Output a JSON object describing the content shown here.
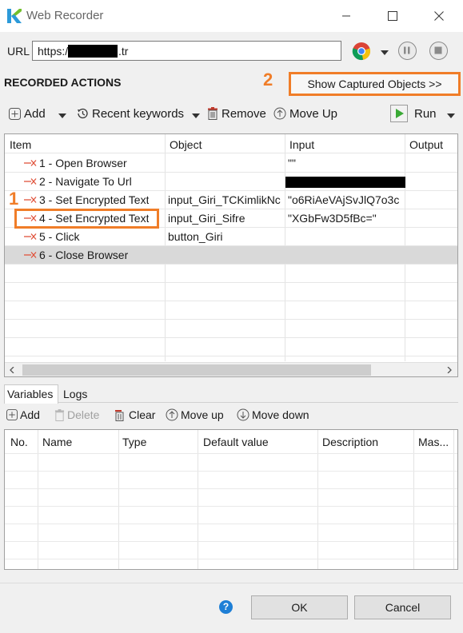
{
  "window": {
    "title": "Web Recorder",
    "minimize": "—",
    "maximize": "☐",
    "close": "✕"
  },
  "url_bar": {
    "label": "URL",
    "value_prefix": "https:/",
    "value_suffix": ".tr"
  },
  "section": {
    "title": "RECORDED ACTIONS",
    "show_captured": "Show Captured Objects >>",
    "annotation_1": "1",
    "annotation_2": "2"
  },
  "toolbar": {
    "add": "Add",
    "recent_keywords": "Recent keywords",
    "remove": "Remove",
    "move_up": "Move Up",
    "run": "Run"
  },
  "actions_table": {
    "columns": [
      "Item",
      "Object",
      "Input",
      "Output"
    ],
    "rows": [
      {
        "item": "1 - Open Browser",
        "object": "",
        "input": "\"\""
      },
      {
        "item": "2 - Navigate To Url",
        "object": "",
        "input": ""
      },
      {
        "item": "3 - Set Encrypted Text",
        "object": "input_Giri_TCKimlikNc",
        "input": "\"o6RiAeVAjSvJlQ7o3c"
      },
      {
        "item": "4 - Set Encrypted Text",
        "object": "input_Giri_Sifre",
        "input": "\"XGbFw3D5fBc=\""
      },
      {
        "item": "5 - Click",
        "object": "button_Giri",
        "input": ""
      },
      {
        "item": "6 - Close Browser",
        "object": "",
        "input": ""
      }
    ]
  },
  "tabs": {
    "variables": "Variables",
    "logs": "Logs"
  },
  "var_toolbar": {
    "add": "Add",
    "delete": "Delete",
    "clear": "Clear",
    "move_up": "Move up",
    "move_down": "Move down"
  },
  "variables_table": {
    "columns": [
      "No.",
      "Name",
      "Type",
      "Default value",
      "Description",
      "Mas..."
    ]
  },
  "footer": {
    "help": "?",
    "ok": "OK",
    "cancel": "Cancel"
  },
  "colors": {
    "highlight": "#f07d28",
    "keyword_icon": "#e0533c",
    "run_green": "#3aa935"
  }
}
